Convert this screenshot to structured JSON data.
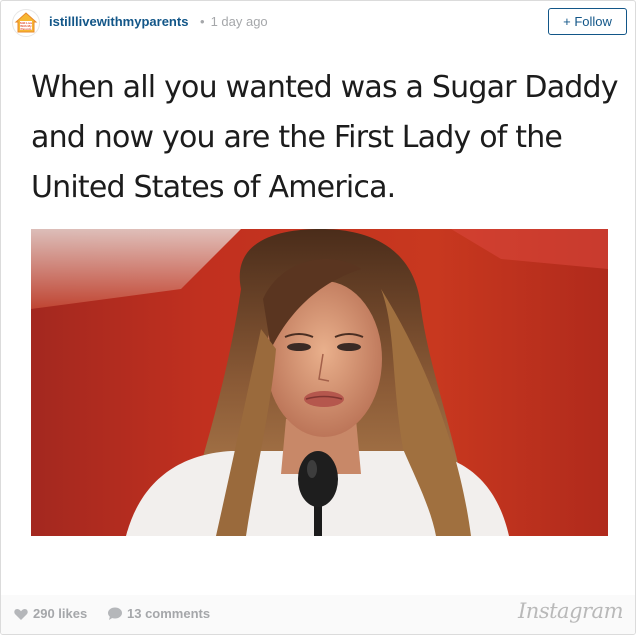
{
  "post": {
    "username": "istilllivewithmyparents",
    "time_ago": "1 day ago",
    "follow_label": "+ Follow",
    "avatar_text": [
      "Still Live",
      "With My",
      "Parents"
    ]
  },
  "meme": {
    "caption": "When all you wanted was a Sugar Daddy and now you are the First Lady of the United States of America."
  },
  "stats": {
    "likes": "290 likes",
    "comments": "13 comments"
  },
  "brand": {
    "name": "Instagram"
  },
  "icons": {
    "avatar": "house-logo-icon",
    "likes": "heart-icon",
    "comments": "speech-bubble-icon",
    "microphone": "microphone-icon"
  },
  "colors": {
    "username": "#125688",
    "muted": "#a5a7aa",
    "background_red": "#b22a1e"
  }
}
